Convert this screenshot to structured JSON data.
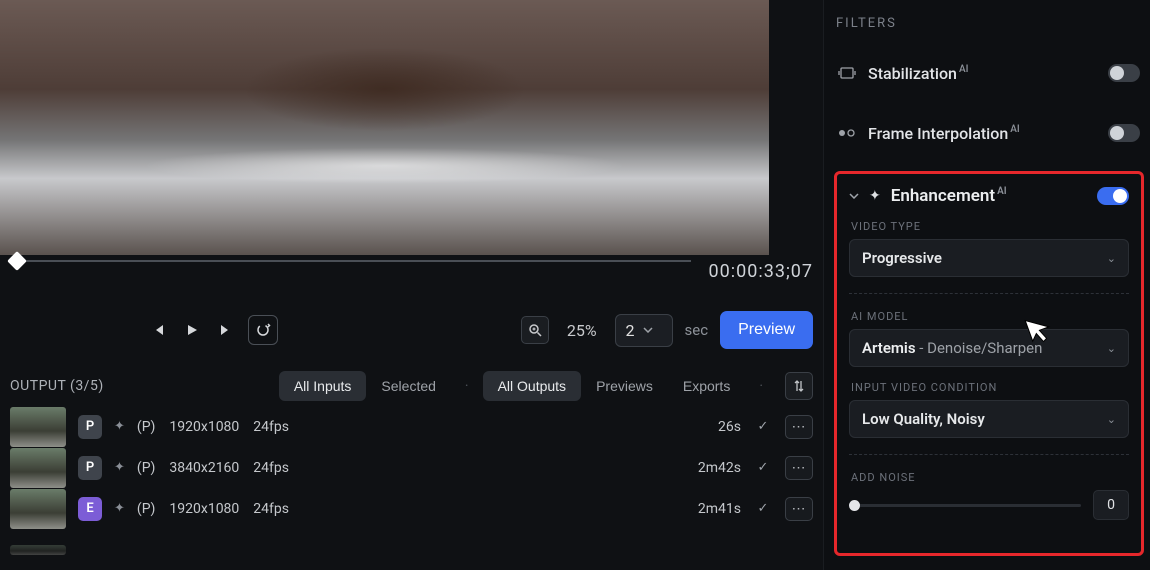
{
  "preview": {
    "timecode": "00:00:33;07",
    "zoom": "25%",
    "seconds_value": "2",
    "seconds_unit": "sec",
    "preview_button": "Preview"
  },
  "output": {
    "header": "OUTPUT (3/5)",
    "tabs": {
      "inputs": [
        "All Inputs",
        "Selected"
      ],
      "outputs": [
        "All Outputs",
        "Previews",
        "Exports"
      ],
      "active_input": 0,
      "active_output": 0
    },
    "rows": [
      {
        "badge": "P",
        "badge_variant": "p",
        "mode": "(P)",
        "res": "1920x1080",
        "fps": "24fps",
        "dur": "26s"
      },
      {
        "badge": "P",
        "badge_variant": "p",
        "mode": "(P)",
        "res": "3840x2160",
        "fps": "24fps",
        "dur": "2m42s"
      },
      {
        "badge": "E",
        "badge_variant": "e",
        "mode": "(P)",
        "res": "1920x1080",
        "fps": "24fps",
        "dur": "2m41s"
      }
    ]
  },
  "sidebar": {
    "filters_header": "FILTERS",
    "stabilization": {
      "label": "Stabilization",
      "sup": "AI",
      "on": false
    },
    "frame_interp": {
      "label": "Frame Interpolation",
      "sup": "AI",
      "on": false
    },
    "enhancement": {
      "label": "Enhancement",
      "sup": "AI",
      "on": true,
      "video_type_label": "VIDEO TYPE",
      "video_type_value": "Progressive",
      "ai_model_label": "AI MODEL",
      "ai_model_strong": "Artemis",
      "ai_model_rest": " - Denoise/Sharpen",
      "ivc_label": "INPUT VIDEO CONDITION",
      "ivc_value": "Low Quality, Noisy",
      "add_noise_label": "ADD NOISE",
      "add_noise_value": "0"
    }
  }
}
